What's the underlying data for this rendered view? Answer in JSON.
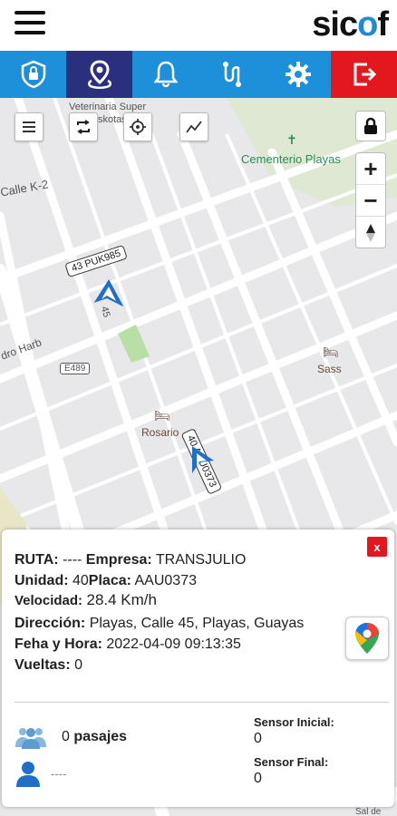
{
  "app": {
    "logo_text_1": "sic",
    "logo_text_2": "o",
    "logo_text_3": "f"
  },
  "nav": {
    "items": [
      {
        "icon": "shield-lock-icon"
      },
      {
        "icon": "location-pin-icon",
        "active": true
      },
      {
        "icon": "bell-icon"
      },
      {
        "icon": "route-icon"
      },
      {
        "icon": "gear-icon"
      },
      {
        "icon": "logout-icon"
      }
    ],
    "colors": {
      "primary": "#1e8fd9",
      "active": "#2a2f7e",
      "exit": "#e3171e"
    }
  },
  "map": {
    "labels": {
      "veterinaria": "Veterinaria Super",
      "veterinaria2": "skotas",
      "cementerio": "Cementerio Playas",
      "calle_k2": "Calle K-2",
      "pedro_harb": "dro Harb",
      "e489": "E489",
      "sass": "Sass",
      "rosario": "Rosario",
      "calle45": "45",
      "salida": "Sal de"
    },
    "vehicles": [
      {
        "tag": "43 PUK985"
      },
      {
        "tag": "40 AAU0373"
      }
    ],
    "zoom_in": "+",
    "zoom_out": "−"
  },
  "panel": {
    "close_label": "x",
    "ruta_label": "RUTA:",
    "ruta_value": "----",
    "empresa_label": "Empresa:",
    "empresa_value": "TRANSJULIO",
    "unidad_label": "Unidad:",
    "unidad_value": "40",
    "placa_label": "Placa:",
    "placa_value": "AAU0373",
    "velocidad_label": "Velocidad:",
    "velocidad_value": "28.4 Km/h",
    "direccion_label": "Dirección:",
    "direccion_value": "Playas, Calle 45, Playas, Guayas",
    "fecha_label": "Feha y Hora:",
    "fecha_value": "2022-04-09 09:13:35",
    "vueltas_label": "Vueltas:",
    "vueltas_value": "0",
    "pasajes_count": "0",
    "pasajes_label": "pasajes",
    "driver_value": "----",
    "sensor_inicial_label": "Sensor Inicial:",
    "sensor_inicial_value": "0",
    "sensor_final_label": "Sensor Final:",
    "sensor_final_value": "0"
  }
}
